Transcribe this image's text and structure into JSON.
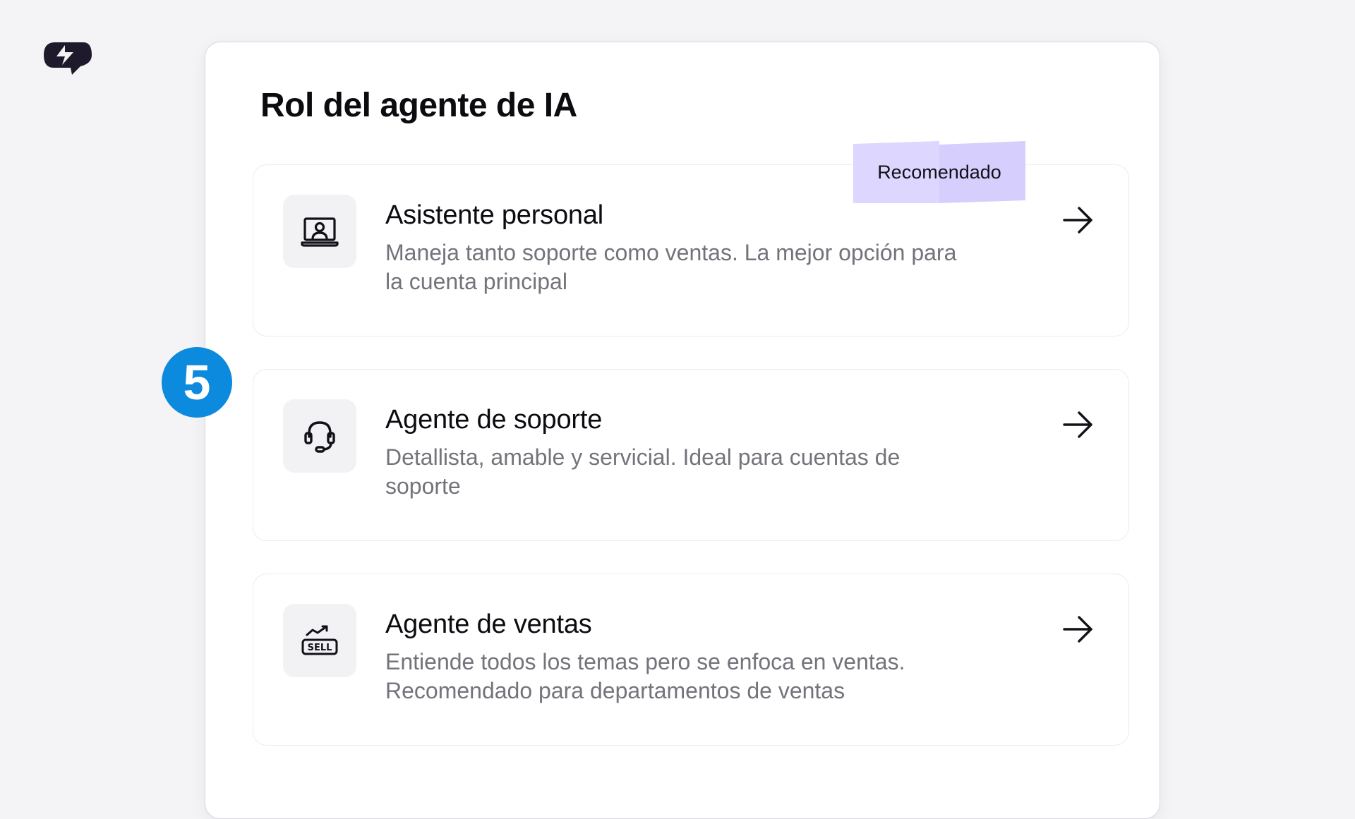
{
  "page": {
    "title": "Rol del agente de IA"
  },
  "badge": {
    "label": "Recomendado",
    "color": "#ddd6fe"
  },
  "step": {
    "number": "5",
    "color": "#0b8ade"
  },
  "options": [
    {
      "title": "Asistente personal",
      "description": "Maneja tanto soporte como ventas. La mejor opción para la cuenta principal",
      "icon": "laptop-user-icon",
      "recommended": true
    },
    {
      "title": "Agente de soporte",
      "description": "Detallista, amable y servicial. Ideal para cuentas de soporte",
      "icon": "headset-icon",
      "recommended": false
    },
    {
      "title": "Agente de ventas",
      "description": "Entiende todos los temas pero se enfoca en ventas. Recomendado para departamentos de ventas",
      "icon": "sell-chart-icon",
      "recommended": false
    }
  ],
  "colors": {
    "background": "#f4f4f6",
    "panel": "#ffffff",
    "text_primary": "#0b0b10",
    "text_secondary": "#73737b",
    "icon_box": "#f2f2f5",
    "logo": "#1f1a2b"
  }
}
